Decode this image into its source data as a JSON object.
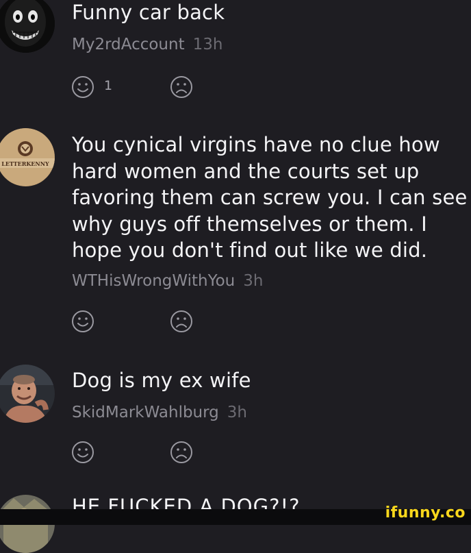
{
  "comments": [
    {
      "text": "Funny car back",
      "author": "My2rdAccount",
      "time": "13h",
      "like_count": "1",
      "avatar_icon": "ghost-face-avatar"
    },
    {
      "text": "You cynical virgins have no clue how\nhard women and the courts set up\nfavoring them can screw you. I can see\nwhy guys off themselves or them. I\nhope you don't find out like we did.",
      "author": "WTHisWrongWithYou",
      "time": "3h",
      "like_count": "",
      "avatar_icon": "letterkenny-avatar",
      "avatar_label": "LETTERKENNY"
    },
    {
      "text": "Dog is my ex wife",
      "author": "SkidMarkWahlburg",
      "time": "3h",
      "like_count": "",
      "avatar_icon": "man-photo-avatar"
    },
    {
      "text": "HE FUCKED A DOG?!?",
      "avatar_icon": "partial-avatar"
    }
  ],
  "watermark": "ifunny.co",
  "colors": {
    "background": "#1e1d22",
    "text": "#f4f4f6",
    "meta": "#8c8b93",
    "brand": "#f9d71c"
  }
}
